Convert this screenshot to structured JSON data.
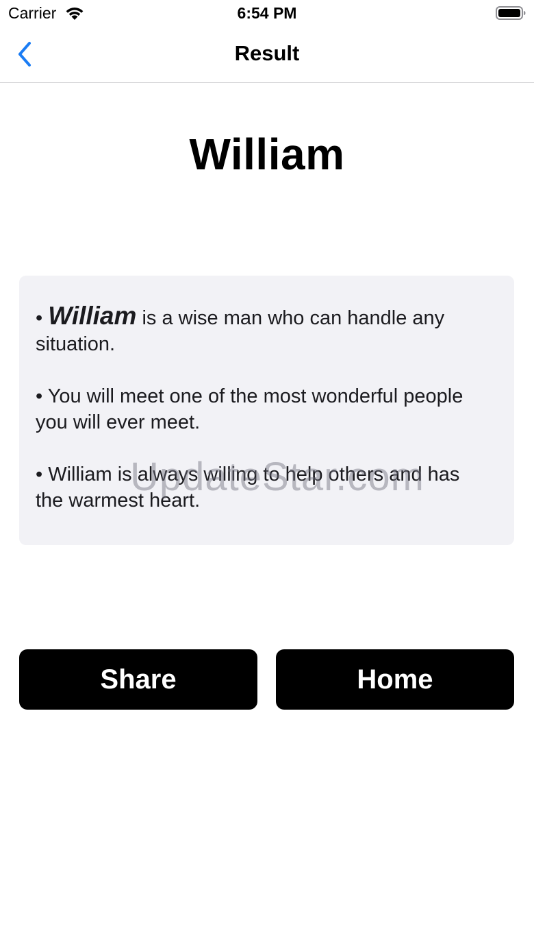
{
  "status_bar": {
    "carrier": "Carrier",
    "time": "6:54 PM",
    "wifi_icon": "wifi-icon",
    "battery_icon": "battery-icon"
  },
  "nav": {
    "title": "Result",
    "back_icon": "chevron-left-icon",
    "accent_color": "#1a7cf4"
  },
  "result": {
    "name": "William",
    "paragraphs": [
      {
        "bullet": "•",
        "name": "William",
        "text": " is a wise man who can handle any situation."
      },
      {
        "bullet": "•",
        "text": " You will meet one of the most wonderful people you will ever meet."
      },
      {
        "bullet": "•",
        "text": " William is always willing to help others and has the warmest heart."
      }
    ]
  },
  "watermark": "UpdateStar.com",
  "buttons": {
    "share_label": "Share",
    "home_label": "Home"
  }
}
